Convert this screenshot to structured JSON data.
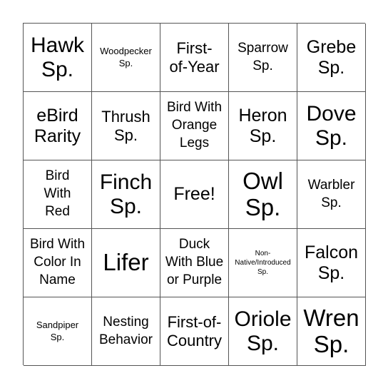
{
  "board": {
    "free_space": "Free!",
    "cells": [
      "Hawk Sp.",
      "Woodpecker Sp.",
      "First-of-Year",
      "Sparrow Sp.",
      "Grebe Sp.",
      "eBird Rarity",
      "Thrush Sp.",
      "Bird With Orange Legs",
      "Heron Sp.",
      "Dove Sp.",
      "Bird With Red",
      "Finch Sp.",
      "Free!",
      "Owl Sp.",
      "Warbler Sp.",
      "Bird With Color In Name",
      "Lifer",
      "Duck With Blue or Purple",
      "Non-Native/Introduced Sp.",
      "Falcon Sp.",
      "Sandpiper Sp.",
      "Nesting Behavior",
      "First-of-Country",
      "Oriole Sp.",
      "Wren Sp."
    ],
    "lines": [
      [
        "Hawk",
        "Sp."
      ],
      [
        "Woodpecker",
        "Sp."
      ],
      [
        "First-",
        "of-Year"
      ],
      [
        "Sparrow",
        "Sp."
      ],
      [
        "Grebe",
        "Sp."
      ],
      [
        "eBird",
        "Rarity"
      ],
      [
        "Thrush",
        "Sp."
      ],
      [
        "Bird With",
        "Orange",
        "Legs"
      ],
      [
        "Heron",
        "Sp."
      ],
      [
        "Dove",
        "Sp."
      ],
      [
        "Bird",
        "With",
        "Red"
      ],
      [
        "Finch",
        "Sp."
      ],
      [
        "Free!"
      ],
      [
        "Owl",
        "Sp."
      ],
      [
        "Warbler",
        "Sp."
      ],
      [
        "Bird With",
        "Color In",
        "Name"
      ],
      [
        "Lifer"
      ],
      [
        "Duck",
        "With Blue",
        "or Purple"
      ],
      [
        "Non-",
        "Native/Introduced",
        "Sp."
      ],
      [
        "Falcon",
        "Sp."
      ],
      [
        "Sandpiper",
        "Sp."
      ],
      [
        "Nesting",
        "Behavior"
      ],
      [
        "First-of-",
        "Country"
      ],
      [
        "Oriole",
        "Sp."
      ],
      [
        "Wren",
        "Sp."
      ]
    ]
  }
}
